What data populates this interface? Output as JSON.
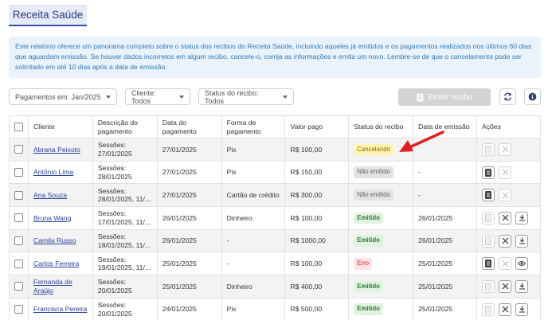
{
  "page": {
    "title": "Receita Saúde"
  },
  "info": "Este relatório oferece um panorama completo sobre o status dos recibos do Receita Saúde, incluindo aqueles já emitidos e os pagamentos realizados nos últimos 60 dias que aguardam emissão. Se houver dados incorretos em algum recibo, cancele-o, corrija as informações e emita um novo. Lembre-se de que o cancelamento pode ser solicitado em até 10 dias após a data de emissão.",
  "filters": {
    "payments": "Pagamentos em: Jan/2025",
    "client": "Cliente: Todos",
    "status": "Status do recibo: Todos"
  },
  "toolbar": {
    "emit_label": "Emitir recibo"
  },
  "table": {
    "headers": {
      "client": "Cliente",
      "desc_1": "Descrição do",
      "desc_2": "pagamento",
      "date_1": "Data do",
      "date_2": "pagamento",
      "method_1": "Forma de",
      "method_2": "pagamento",
      "value": "Valor pago",
      "status": "Status do recibo",
      "emission": "Data de emissão",
      "actions": "Ações"
    },
    "rows": [
      {
        "client": "Abrana Peixoto",
        "desc_1": "Sessões:",
        "desc_2": "27/01/2025",
        "date": "27/01/2025",
        "method": "Pix",
        "value": "R$ 100,00",
        "status": "Cancelando",
        "emission": ""
      },
      {
        "client": "Antônio Lima",
        "desc_1": "Sessões:",
        "desc_2": "28/01/2025",
        "date": "27/01/2025",
        "method": "Pix",
        "value": "R$ 150,00",
        "status": "Não emitido",
        "emission": "-"
      },
      {
        "client": "Ana Souza",
        "desc_1": "Sessões:",
        "desc_2": "28/01/2025, 11/...",
        "date": "27/01/2025",
        "method": "Cartão de crédito",
        "value": "R$ 300,00",
        "status": "Não emitido",
        "emission": "-"
      },
      {
        "client": "Bruna Wang",
        "desc_1": "Sessões:",
        "desc_2": "17/01/2025, 11/...",
        "date": "26/01/2025",
        "method": "Dinheiro",
        "value": "R$ 100,00",
        "status": "Emitido",
        "emission": "26/01/2025"
      },
      {
        "client": "Camila Russo",
        "desc_1": "Sessões:",
        "desc_2": "18/01/2025, 11/...",
        "date": "26/01/2025",
        "method": "-",
        "value": "R$ 1000,00",
        "status": "Emitido",
        "emission": "26/01/2025"
      },
      {
        "client": "Carlos Ferreira",
        "desc_1": "Sessões:",
        "desc_2": "19/01/2025, 11/...",
        "date": "25/01/2025",
        "method": "-",
        "value": "R$ 100,00",
        "status": "Erro",
        "emission": "25/01/2025"
      },
      {
        "client": "Fernanda de Araújo",
        "desc_1": "Sessões:",
        "desc_2": "20/01/2025",
        "date": "25/01/2025",
        "method": "Dinheiro",
        "value": "R$ 400,00",
        "status": "Emitido",
        "emission": "25/01/2025"
      },
      {
        "client": "Francisca Pereira",
        "desc_1": "Sessões:",
        "desc_2": "20/01/2025",
        "date": "24/01/2025",
        "method": "Pix",
        "value": "R$ 500,00",
        "status": "Emitido",
        "emission": "25/01/2025"
      }
    ]
  },
  "colors": {
    "accent": "#3a4fa3",
    "info_text": "#2f79b7",
    "arrow": "#e02020"
  }
}
